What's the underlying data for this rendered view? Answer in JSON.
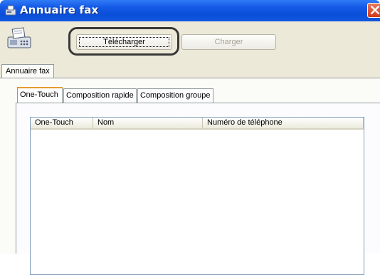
{
  "window": {
    "title": "Annuaire fax",
    "title_icon": "fax-small-icon",
    "close_icon": "close-icon"
  },
  "toolbar": {
    "app_icon": "fax-machine-icon",
    "download_label": "Télécharger",
    "load_label": "Charger"
  },
  "outer_tab": {
    "label": "Annuaire fax"
  },
  "tabs": [
    {
      "label": "One-Touch",
      "active": true
    },
    {
      "label": "Composition rapide",
      "active": false
    },
    {
      "label": "Composition groupe",
      "active": false
    }
  ],
  "list": {
    "columns": [
      "One-Touch",
      "Nom",
      "Numéro de téléphone"
    ],
    "rows": []
  },
  "colors": {
    "titlebar": "#0a4fd8",
    "window": "#ece9d8",
    "close": "#d2391a",
    "active_tab_accent": "#e79b2d"
  }
}
